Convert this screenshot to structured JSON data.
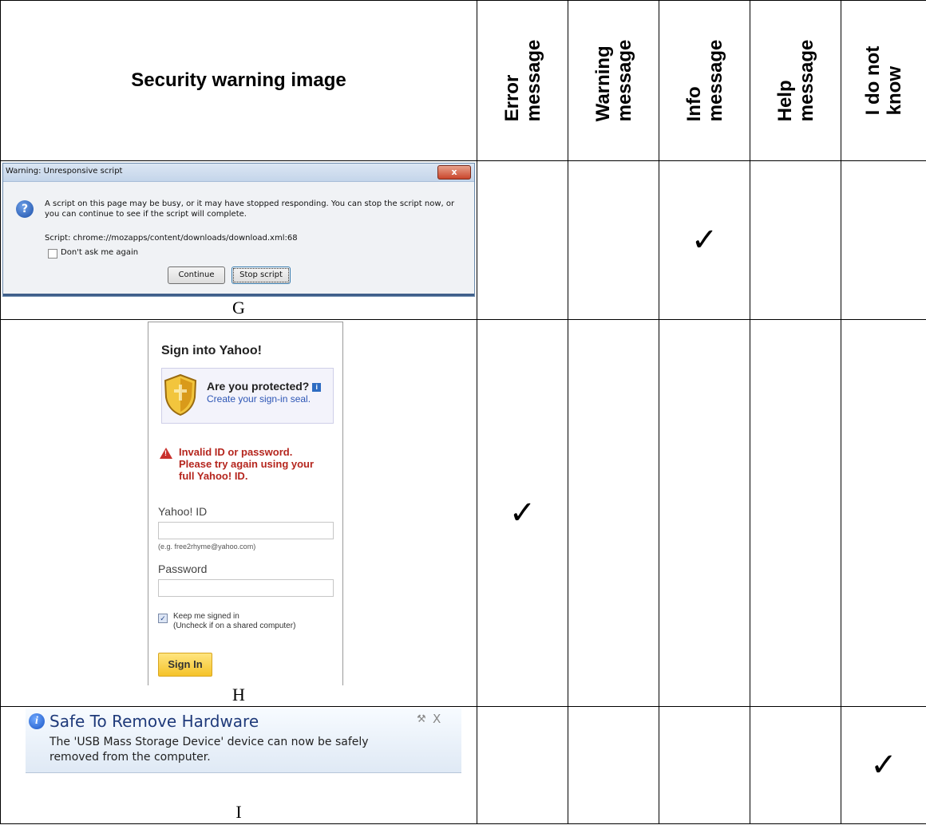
{
  "header": {
    "image_col": "Security warning image",
    "choices": [
      "Error\nmessage",
      "Warning\nmessage",
      "Info\nmessage",
      "Help\nmessage",
      "I do not\nknow"
    ]
  },
  "rows": [
    {
      "caption": "G",
      "checked_choice": "Info\nmessage"
    },
    {
      "caption": "H",
      "checked_choice": "Error\nmessage"
    },
    {
      "caption": "I",
      "checked_choice": "I do not\nknow"
    }
  ],
  "check_mark": "✓",
  "dialog_g": {
    "title": "Warning: Unresponsive script",
    "close": "x",
    "icon": "?",
    "message": "A script on this page may be busy, or it may have stopped responding. You can stop the script now, or you can continue to see if the script will complete.",
    "script": "Script: chrome://mozapps/content/downloads/download.xml:68",
    "checkbox_label": "Don't ask me again",
    "continue": "Continue",
    "stop": "Stop script"
  },
  "yahoo_h": {
    "title": "Sign into Yahoo!",
    "seal_question": "Are you protected?",
    "seal_info": "i",
    "seal_link": "Create your sign-in seal.",
    "error": "Invalid ID or password.\nPlease try again using your\nfull Yahoo! ID.",
    "error_icon": "!",
    "id_label": "Yahoo! ID",
    "id_hint": "(e.g. free2rhyme@yahoo.com)",
    "password_label": "Password",
    "keep_checkmark": "✓",
    "keep_signed": "Keep me signed in\n(Uncheck if on a shared computer)",
    "sign_in": "Sign In"
  },
  "notification_i": {
    "icon": "i",
    "title": "Safe To Remove Hardware",
    "tool": "⚒",
    "close": "X",
    "body": "The 'USB Mass Storage Device' device can now be safely\nremoved from the computer."
  },
  "colors": {
    "yahoo_error": "#b5261e",
    "yahoo_button": "#f5c32a",
    "notification_title": "#1f3a7a"
  }
}
